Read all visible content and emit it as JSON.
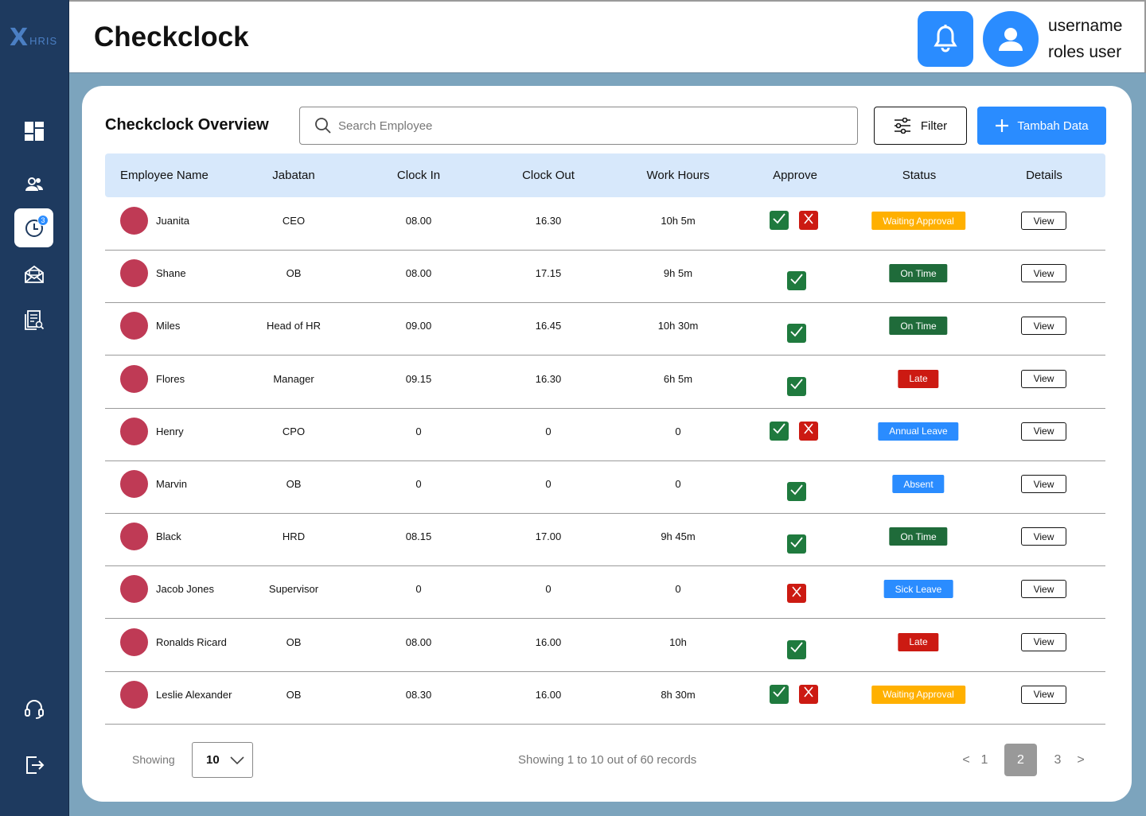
{
  "app": {
    "logo_mark": "X",
    "logo_text": "HRIS"
  },
  "header": {
    "title": "Checkclock",
    "username": "username",
    "role": "roles user"
  },
  "sidebar": {
    "items": [
      {
        "name": "dashboard",
        "icon": "dashboard-icon",
        "active": false
      },
      {
        "name": "employees",
        "icon": "users-icon",
        "active": false
      },
      {
        "name": "checkclock",
        "icon": "clock-icon",
        "active": true,
        "badge": "3"
      },
      {
        "name": "letters",
        "icon": "mail-icon",
        "active": false
      },
      {
        "name": "reports",
        "icon": "report-search-icon",
        "active": false
      }
    ],
    "bottom": [
      {
        "name": "support",
        "icon": "headset-icon"
      },
      {
        "name": "logout",
        "icon": "logout-icon"
      }
    ]
  },
  "overview": {
    "title": "Checkclock Overview",
    "search_placeholder": "Search Employee",
    "filter_label": "Filter",
    "add_label": "Tambah Data"
  },
  "table": {
    "headers": [
      "Employee Name",
      "Jabatan",
      "Clock In",
      "Clock Out",
      "Work Hours",
      "Approve",
      "Status",
      "Details"
    ],
    "rows": [
      {
        "name": "Juanita",
        "jabatan": "CEO",
        "clock_in": "08.00",
        "clock_out": "16.30",
        "work_hours": "10h 5m",
        "approve": "both",
        "status": "Waiting Approval",
        "status_color": "#ffb000",
        "details": "View"
      },
      {
        "name": "Shane",
        "jabatan": "OB",
        "clock_in": "08.00",
        "clock_out": "17.15",
        "work_hours": "9h 5m",
        "approve": "ok",
        "status": "On Time",
        "status_color": "#1f6b3a",
        "details": "View"
      },
      {
        "name": "Miles",
        "jabatan": "Head of HR",
        "clock_in": "09.00",
        "clock_out": "16.45",
        "work_hours": "10h 30m",
        "approve": "ok",
        "status": "On Time",
        "status_color": "#1f6b3a",
        "details": "View"
      },
      {
        "name": "Flores",
        "jabatan": "Manager",
        "clock_in": "09.15",
        "clock_out": "16.30",
        "work_hours": "6h 5m",
        "approve": "ok",
        "status": "Late",
        "status_color": "#cc1a12",
        "details": "View"
      },
      {
        "name": "Henry",
        "jabatan": "CPO",
        "clock_in": "0",
        "clock_out": "0",
        "work_hours": "0",
        "approve": "both",
        "status": "Annual Leave",
        "status_color": "#2a8cff",
        "details": "View"
      },
      {
        "name": "Marvin",
        "jabatan": "OB",
        "clock_in": "0",
        "clock_out": "0",
        "work_hours": "0",
        "approve": "ok",
        "status": "Absent",
        "status_color": "#2a8cff",
        "details": "View"
      },
      {
        "name": "Black",
        "jabatan": "HRD",
        "clock_in": "08.15",
        "clock_out": "17.00",
        "work_hours": "9h 45m",
        "approve": "ok",
        "status": "On Time",
        "status_color": "#1f6b3a",
        "details": "View"
      },
      {
        "name": "Jacob Jones",
        "jabatan": "Supervisor",
        "clock_in": "0",
        "clock_out": "0",
        "work_hours": "0",
        "approve": "no",
        "status": "Sick Leave",
        "status_color": "#2a8cff",
        "details": "View"
      },
      {
        "name": "Ronalds Ricard",
        "jabatan": "OB",
        "clock_in": "08.00",
        "clock_out": "16.00",
        "work_hours": "10h",
        "approve": "ok",
        "status": "Late",
        "status_color": "#cc1a12",
        "details": "View"
      },
      {
        "name": "Leslie Alexander",
        "jabatan": "OB",
        "clock_in": "08.30",
        "clock_out": "16.00",
        "work_hours": "8h 30m",
        "approve": "both",
        "status": "Waiting Approval",
        "status_color": "#ffb000",
        "details": "View"
      }
    ]
  },
  "footer": {
    "showing_label": "Showing",
    "page_size": "10",
    "records_text": "Showing 1 to 10 out of 60 records",
    "prev": "<",
    "next": ">",
    "pages": [
      "1",
      "2",
      "3"
    ],
    "current_page": "2"
  },
  "colors": {
    "sidebar": "#1e3a5f",
    "accent": "#2a8cff",
    "approve_green": "#1f7a3e",
    "reject_red": "#cc1a12",
    "avatar": "#bf3a55"
  }
}
